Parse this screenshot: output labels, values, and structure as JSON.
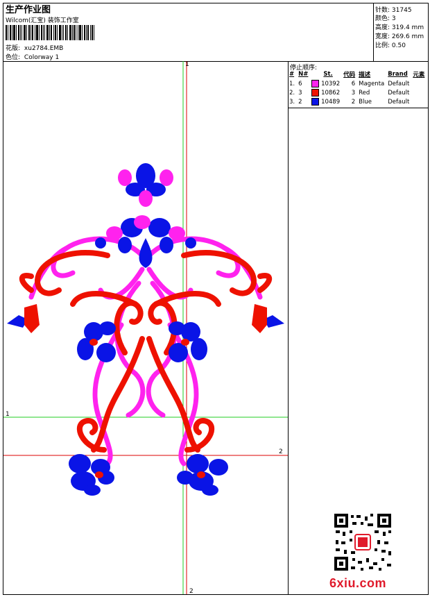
{
  "header": {
    "title": "生产作业图",
    "company": "Wilcom(汇宝) 装饰工作室",
    "design_label": "花版:",
    "design_name": "xu2784.EMB",
    "colorway_label": "色位:",
    "colorway_name": "Colorway 1"
  },
  "stats": [
    {
      "label": "针数:",
      "value": "31745"
    },
    {
      "label": "颜色:",
      "value": "3"
    },
    {
      "label": "高度:",
      "value": "319.4 mm"
    },
    {
      "label": "宽度:",
      "value": "269.6 mm"
    },
    {
      "label": "比例:",
      "value": "0.50"
    }
  ],
  "stop_sequence": {
    "title": "停止顺序:",
    "columns": [
      "#",
      "N#",
      "St.",
      "代码",
      "描述",
      "Brand",
      "元素"
    ],
    "rows": [
      {
        "num": "1.",
        "needle": "6",
        "stitches": "10392",
        "code": "6",
        "desc": "Magenta",
        "brand": "Default",
        "color": "#ff22ee"
      },
      {
        "num": "2.",
        "needle": "3",
        "stitches": "10862",
        "code": "3",
        "desc": "Red",
        "brand": "Default",
        "color": "#ee1100"
      },
      {
        "num": "3.",
        "needle": "2",
        "stitches": "10489",
        "code": "2",
        "desc": "Blue",
        "brand": "Default",
        "color": "#0a14e6"
      }
    ]
  },
  "guides": {
    "top_label": "1",
    "left_label": "1",
    "right_label": "2",
    "bottom_label": "2",
    "green": "#22cc22",
    "red": "#dd0000"
  },
  "watermark": {
    "site": "6xiu.com"
  }
}
